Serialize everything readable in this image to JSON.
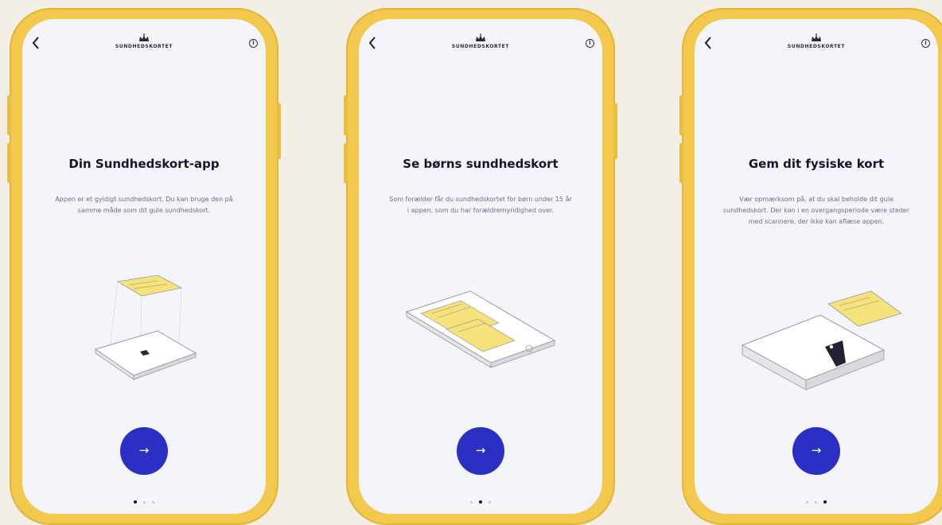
{
  "brand": "SUNDHEDSKORTET",
  "icons": {
    "back": "chevron-left-icon",
    "info": "info-icon",
    "next": "arrow-right-icon",
    "crown": "crown-icon"
  },
  "colors": {
    "background": "#f3efe6",
    "phone": "#f2c94c",
    "screen": "#f4f4fb",
    "accent": "#2b2fc4"
  },
  "arrow_glyph": "→",
  "screens": [
    {
      "title": "Din Sundhedskort-app",
      "description": "Appen er et gyldigt sundhedskort. Du kan bruge den på samme måde som dit gule sundhedskort.",
      "active_dot": 0
    },
    {
      "title": "Se børns sundhedskort",
      "description": "Som forælder får du sundhedskortet for børn under 15 år i appen, som du har forældremyndighed over.",
      "active_dot": 1
    },
    {
      "title": "Gem dit fysiske kort",
      "description": "Vær opmærksom på, at du skal beholde dit gule sundhedskort. Der kan i en overgangsperiode være steder med scannere, der ikke kan aflæse appen.",
      "active_dot": 2
    }
  ]
}
